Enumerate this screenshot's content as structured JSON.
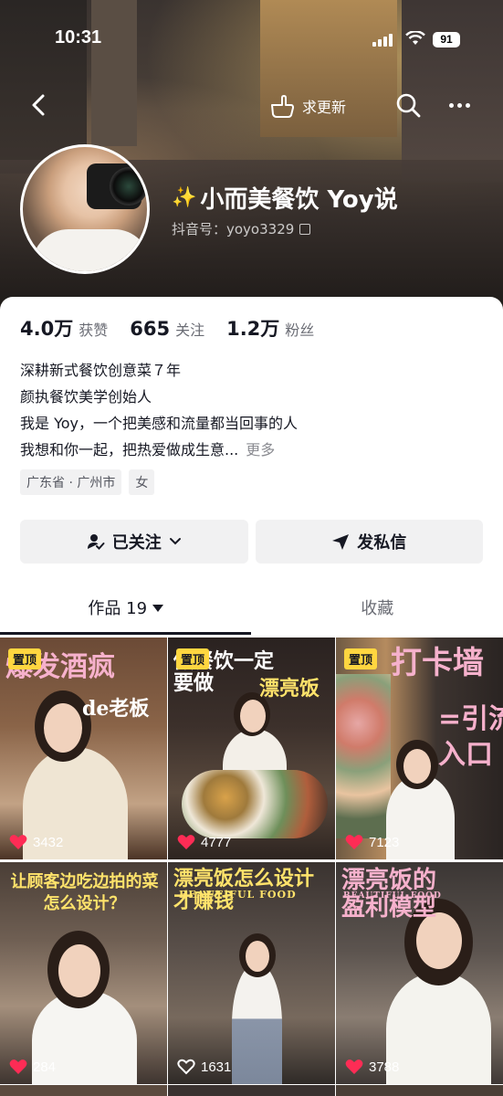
{
  "status_bar": {
    "time": "10:31",
    "battery": "91"
  },
  "header": {
    "update_label": "求更新"
  },
  "profile": {
    "name": "小而美餐饮 Yoy说",
    "douyin_id": "抖音号：yoyo3329",
    "stats": [
      {
        "num": "4.0万",
        "label": "获赞"
      },
      {
        "num": "665",
        "label": "关注"
      },
      {
        "num": "1.2万",
        "label": "粉丝"
      }
    ],
    "bio": [
      "深耕新式餐饮创意菜７年",
      "颜执餐饮美学创始人",
      "我是 Yoy，一个把美感和流量都当回事的人",
      "我想和你一起，把热爱做成生意..."
    ],
    "bio_more": "更多",
    "tags": [
      "广东省 · 广州市",
      "女"
    ],
    "follow_label": "已关注",
    "message_label": "发私信"
  },
  "tabs": {
    "works": "作品 19",
    "favorites": "收藏"
  },
  "posts": [
    {
      "pinned": "置顶",
      "title": "爆发酒疯",
      "subtitle": "de老板",
      "likes": "3432",
      "liked": true
    },
    {
      "pinned": "置顶",
      "title": "做餐饮一定\n要做",
      "subtitle": "漂亮饭",
      "likes": "4777",
      "liked": true
    },
    {
      "pinned": "置顶",
      "title": "打卡墙",
      "subtitle": "=引流\n入口",
      "likes": "7123",
      "liked": true
    },
    {
      "pinned": "",
      "title": "让顾客边吃边拍的菜\n怎么设计？",
      "subtitle": "",
      "likes": "284",
      "liked": true
    },
    {
      "pinned": "",
      "title": "漂亮饭怎么设计\n才赚钱",
      "subtitle": "BEAUTIFUL FOOD",
      "likes": "1631",
      "liked": false
    },
    {
      "pinned": "",
      "title": "漂亮饭的\n盈利模型",
      "subtitle": "BEAUTIFUL FOOD",
      "likes": "3788",
      "liked": true
    }
  ],
  "colors": {
    "pin": "#ffd640",
    "heart": "#fe2c55",
    "accent_title_pink": "#f3b4d0",
    "accent_title_yellow": "#ffe36b"
  }
}
